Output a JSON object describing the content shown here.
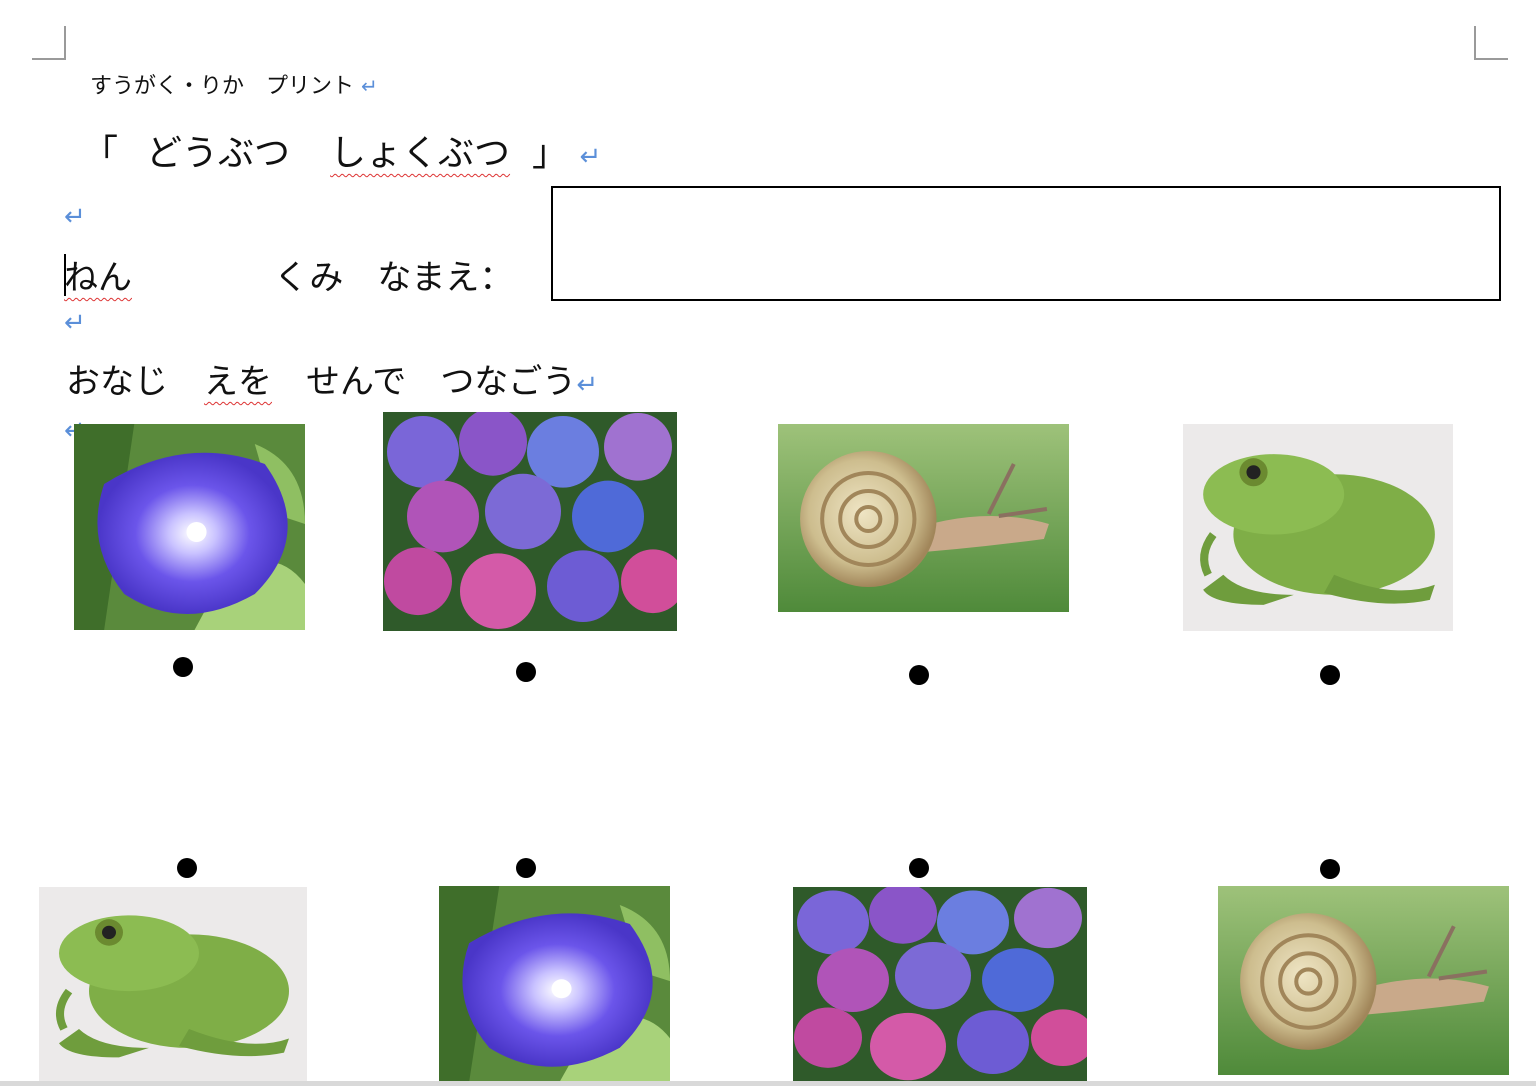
{
  "subtitle": "すうがく・りか　プリント",
  "title": {
    "open_bracket": "「",
    "word1": "どうぶつ",
    "word2": "しょくぶつ",
    "close_bracket": "」"
  },
  "name_line": {
    "nen": "ねん",
    "kumi": "くみ",
    "namae": "なまえ："
  },
  "instruction": {
    "part1": "おなじ",
    "part2": "えを",
    "part3": "せんで",
    "part4": "つなごう"
  },
  "return_mark": "↵",
  "top_row": [
    "morning-glory",
    "hydrangea",
    "snail",
    "frog"
  ],
  "bottom_row": [
    "frog",
    "morning-glory",
    "hydrangea",
    "snail"
  ]
}
